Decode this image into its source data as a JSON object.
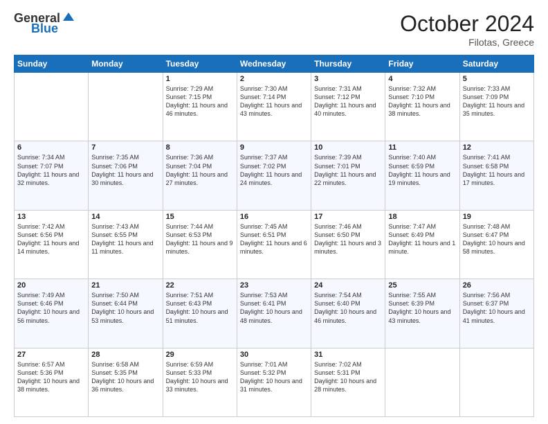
{
  "header": {
    "logo_general": "General",
    "logo_blue": "Blue",
    "month_title": "October 2024",
    "location": "Filotas, Greece"
  },
  "days_of_week": [
    "Sunday",
    "Monday",
    "Tuesday",
    "Wednesday",
    "Thursday",
    "Friday",
    "Saturday"
  ],
  "weeks": [
    [
      {
        "day": "",
        "text": ""
      },
      {
        "day": "",
        "text": ""
      },
      {
        "day": "1",
        "text": "Sunrise: 7:29 AM\nSunset: 7:15 PM\nDaylight: 11 hours and 46 minutes."
      },
      {
        "day": "2",
        "text": "Sunrise: 7:30 AM\nSunset: 7:14 PM\nDaylight: 11 hours and 43 minutes."
      },
      {
        "day": "3",
        "text": "Sunrise: 7:31 AM\nSunset: 7:12 PM\nDaylight: 11 hours and 40 minutes."
      },
      {
        "day": "4",
        "text": "Sunrise: 7:32 AM\nSunset: 7:10 PM\nDaylight: 11 hours and 38 minutes."
      },
      {
        "day": "5",
        "text": "Sunrise: 7:33 AM\nSunset: 7:09 PM\nDaylight: 11 hours and 35 minutes."
      }
    ],
    [
      {
        "day": "6",
        "text": "Sunrise: 7:34 AM\nSunset: 7:07 PM\nDaylight: 11 hours and 32 minutes."
      },
      {
        "day": "7",
        "text": "Sunrise: 7:35 AM\nSunset: 7:06 PM\nDaylight: 11 hours and 30 minutes."
      },
      {
        "day": "8",
        "text": "Sunrise: 7:36 AM\nSunset: 7:04 PM\nDaylight: 11 hours and 27 minutes."
      },
      {
        "day": "9",
        "text": "Sunrise: 7:37 AM\nSunset: 7:02 PM\nDaylight: 11 hours and 24 minutes."
      },
      {
        "day": "10",
        "text": "Sunrise: 7:39 AM\nSunset: 7:01 PM\nDaylight: 11 hours and 22 minutes."
      },
      {
        "day": "11",
        "text": "Sunrise: 7:40 AM\nSunset: 6:59 PM\nDaylight: 11 hours and 19 minutes."
      },
      {
        "day": "12",
        "text": "Sunrise: 7:41 AM\nSunset: 6:58 PM\nDaylight: 11 hours and 17 minutes."
      }
    ],
    [
      {
        "day": "13",
        "text": "Sunrise: 7:42 AM\nSunset: 6:56 PM\nDaylight: 11 hours and 14 minutes."
      },
      {
        "day": "14",
        "text": "Sunrise: 7:43 AM\nSunset: 6:55 PM\nDaylight: 11 hours and 11 minutes."
      },
      {
        "day": "15",
        "text": "Sunrise: 7:44 AM\nSunset: 6:53 PM\nDaylight: 11 hours and 9 minutes."
      },
      {
        "day": "16",
        "text": "Sunrise: 7:45 AM\nSunset: 6:51 PM\nDaylight: 11 hours and 6 minutes."
      },
      {
        "day": "17",
        "text": "Sunrise: 7:46 AM\nSunset: 6:50 PM\nDaylight: 11 hours and 3 minutes."
      },
      {
        "day": "18",
        "text": "Sunrise: 7:47 AM\nSunset: 6:49 PM\nDaylight: 11 hours and 1 minute."
      },
      {
        "day": "19",
        "text": "Sunrise: 7:48 AM\nSunset: 6:47 PM\nDaylight: 10 hours and 58 minutes."
      }
    ],
    [
      {
        "day": "20",
        "text": "Sunrise: 7:49 AM\nSunset: 6:46 PM\nDaylight: 10 hours and 56 minutes."
      },
      {
        "day": "21",
        "text": "Sunrise: 7:50 AM\nSunset: 6:44 PM\nDaylight: 10 hours and 53 minutes."
      },
      {
        "day": "22",
        "text": "Sunrise: 7:51 AM\nSunset: 6:43 PM\nDaylight: 10 hours and 51 minutes."
      },
      {
        "day": "23",
        "text": "Sunrise: 7:53 AM\nSunset: 6:41 PM\nDaylight: 10 hours and 48 minutes."
      },
      {
        "day": "24",
        "text": "Sunrise: 7:54 AM\nSunset: 6:40 PM\nDaylight: 10 hours and 46 minutes."
      },
      {
        "day": "25",
        "text": "Sunrise: 7:55 AM\nSunset: 6:39 PM\nDaylight: 10 hours and 43 minutes."
      },
      {
        "day": "26",
        "text": "Sunrise: 7:56 AM\nSunset: 6:37 PM\nDaylight: 10 hours and 41 minutes."
      }
    ],
    [
      {
        "day": "27",
        "text": "Sunrise: 6:57 AM\nSunset: 5:36 PM\nDaylight: 10 hours and 38 minutes."
      },
      {
        "day": "28",
        "text": "Sunrise: 6:58 AM\nSunset: 5:35 PM\nDaylight: 10 hours and 36 minutes."
      },
      {
        "day": "29",
        "text": "Sunrise: 6:59 AM\nSunset: 5:33 PM\nDaylight: 10 hours and 33 minutes."
      },
      {
        "day": "30",
        "text": "Sunrise: 7:01 AM\nSunset: 5:32 PM\nDaylight: 10 hours and 31 minutes."
      },
      {
        "day": "31",
        "text": "Sunrise: 7:02 AM\nSunset: 5:31 PM\nDaylight: 10 hours and 28 minutes."
      },
      {
        "day": "",
        "text": ""
      },
      {
        "day": "",
        "text": ""
      }
    ]
  ]
}
